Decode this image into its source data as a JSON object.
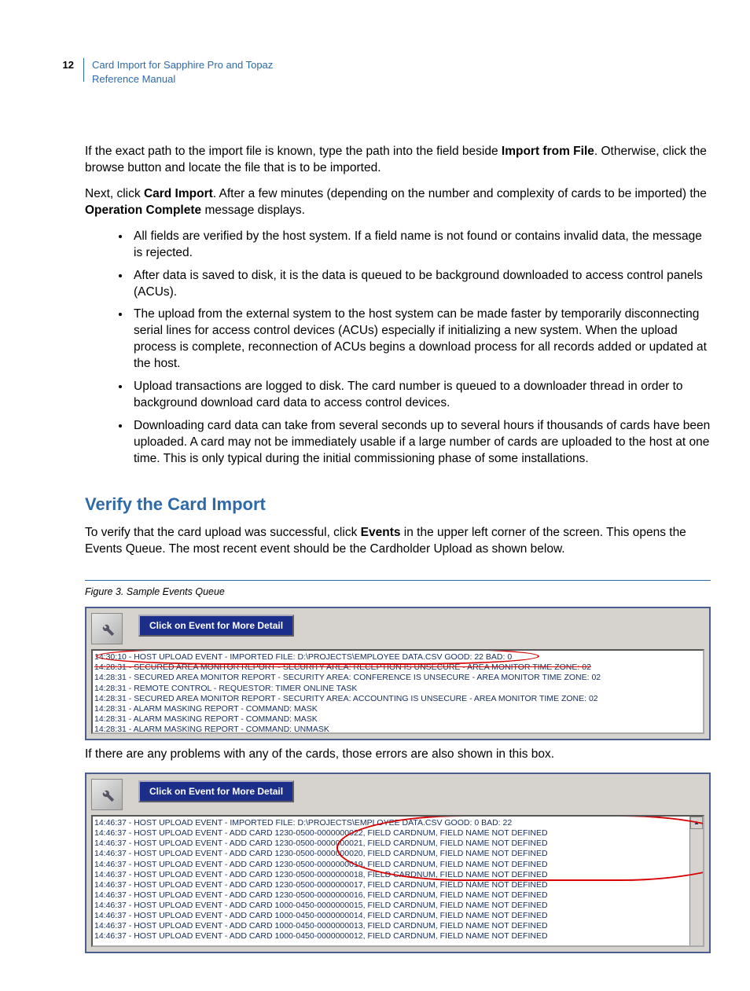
{
  "header": {
    "page_number": "12",
    "title_line1": "Card Import for Sapphire Pro and Topaz",
    "title_line2": "Reference Manual"
  },
  "intro": {
    "p1_a": "If the exact path to the import file is known, type the path into the field beside ",
    "p1_bold": "Import from File",
    "p1_b": ". Otherwise, click the browse button and locate the file that is to be imported.",
    "p2_a": "Next, click ",
    "p2_bold1": "Card Import",
    "p2_b": ". After a few minutes (depending on the number and complexity of cards to be imported) the ",
    "p2_bold2": "Operation Complete",
    "p2_c": " message displays."
  },
  "bullets": [
    "All fields are verified by the host system. If a field name is not found or contains invalid data, the message is rejected.",
    "After data is saved to disk, it is the data is queued to be background downloaded to access control panels (ACUs).",
    "The upload from the external system to the host system can be made faster by temporarily disconnecting serial lines for access control devices (ACUs) especially if initializing a new system. When the upload process is complete, reconnection of ACUs begins a download process for all records added or updated at the host.",
    "Upload transactions are logged to disk. The card number is queued to a downloader thread in order to background download card data to access control devices.",
    "Downloading card data can take from several seconds up to several hours if thousands of cards have been uploaded. A card may not be immediately usable if a large number of cards are uploaded to the host at one time. This is only typical during the initial commissioning phase of some installations."
  ],
  "verify": {
    "heading": "Verify the Card Import",
    "p1_a": "To verify that the card upload was successful, click ",
    "p1_bold": "Events",
    "p1_b": " in the upper left corner of the screen. This opens the Events Queue. The most recent event should be the Cardholder Upload as shown below."
  },
  "figure3": {
    "caption": "Figure 3.  Sample Events Queue",
    "banner": "Click on Event for More Detail",
    "events": [
      "14:30:10 - HOST UPLOAD EVENT  - IMPORTED FILE: D:\\PROJECTS\\EMPLOYEE DATA.CSV  GOOD: 22  BAD: 0",
      "14:28:31 - SECURED AREA MONITOR REPORT  - SECURITY AREA: RECEPTION IS  UNSECURE  - AREA MONITOR TIME ZONE: 02",
      "14:28:31 - SECURED AREA MONITOR REPORT  - SECURITY AREA: CONFERENCE IS  UNSECURE  - AREA MONITOR TIME ZONE: 02",
      "14:28:31 - REMOTE CONTROL  - REQUESTOR: TIMER ONLINE TASK",
      "14:28:31 - SECURED AREA MONITOR REPORT  - SECURITY AREA: ACCOUNTING IS  UNSECURE  - AREA MONITOR TIME ZONE: 02",
      "14:28:31 - ALARM MASKING REPORT  - COMMAND: MASK",
      "14:28:31 - ALARM MASKING REPORT  - COMMAND: MASK",
      "14:28:31 - ALARM MASKING REPORT  - COMMAND: UNMASK"
    ]
  },
  "after_fig3": "If there are any problems with any of the cards, those errors are also shown in this box.",
  "figure4": {
    "banner": "Click on Event for More Detail",
    "events": [
      "14:46:37 - HOST UPLOAD EVENT  - IMPORTED FILE: D:\\PROJECTS\\EMPLOYEE DATA.CSV  GOOD: 0  BAD: 22",
      "14:46:37 - HOST UPLOAD EVENT  - ADD CARD 1230-0500-0000000022, FIELD CARDNUM, FIELD NAME NOT DEFINED",
      "14:46:37 - HOST UPLOAD EVENT  - ADD CARD 1230-0500-0000000021, FIELD CARDNUM, FIELD NAME NOT DEFINED",
      "14:46:37 - HOST UPLOAD EVENT  - ADD CARD 1230-0500-0000000020, FIELD CARDNUM, FIELD NAME NOT DEFINED",
      "14:46:37 - HOST UPLOAD EVENT  - ADD CARD 1230-0500-0000000019, FIELD CARDNUM, FIELD NAME NOT DEFINED",
      "14:46:37 - HOST UPLOAD EVENT  - ADD CARD 1230-0500-0000000018, FIELD CARDNUM, FIELD NAME NOT DEFINED",
      "14:46:37 - HOST UPLOAD EVENT  - ADD CARD 1230-0500-0000000017, FIELD CARDNUM, FIELD NAME NOT DEFINED",
      "14:46:37 - HOST UPLOAD EVENT  - ADD CARD 1230-0500-0000000016, FIELD CARDNUM, FIELD NAME NOT DEFINED",
      "14:46:37 - HOST UPLOAD EVENT  - ADD CARD 1000-0450-0000000015, FIELD CARDNUM, FIELD NAME NOT DEFINED",
      "14:46:37 - HOST UPLOAD EVENT  - ADD CARD 1000-0450-0000000014, FIELD CARDNUM, FIELD NAME NOT DEFINED",
      "14:46:37 - HOST UPLOAD EVENT  - ADD CARD 1000-0450-0000000013, FIELD CARDNUM, FIELD NAME NOT DEFINED",
      "14:46:37 - HOST UPLOAD EVENT  - ADD CARD 1000-0450-0000000012, FIELD CARDNUM, FIELD NAME NOT DEFINED"
    ]
  }
}
